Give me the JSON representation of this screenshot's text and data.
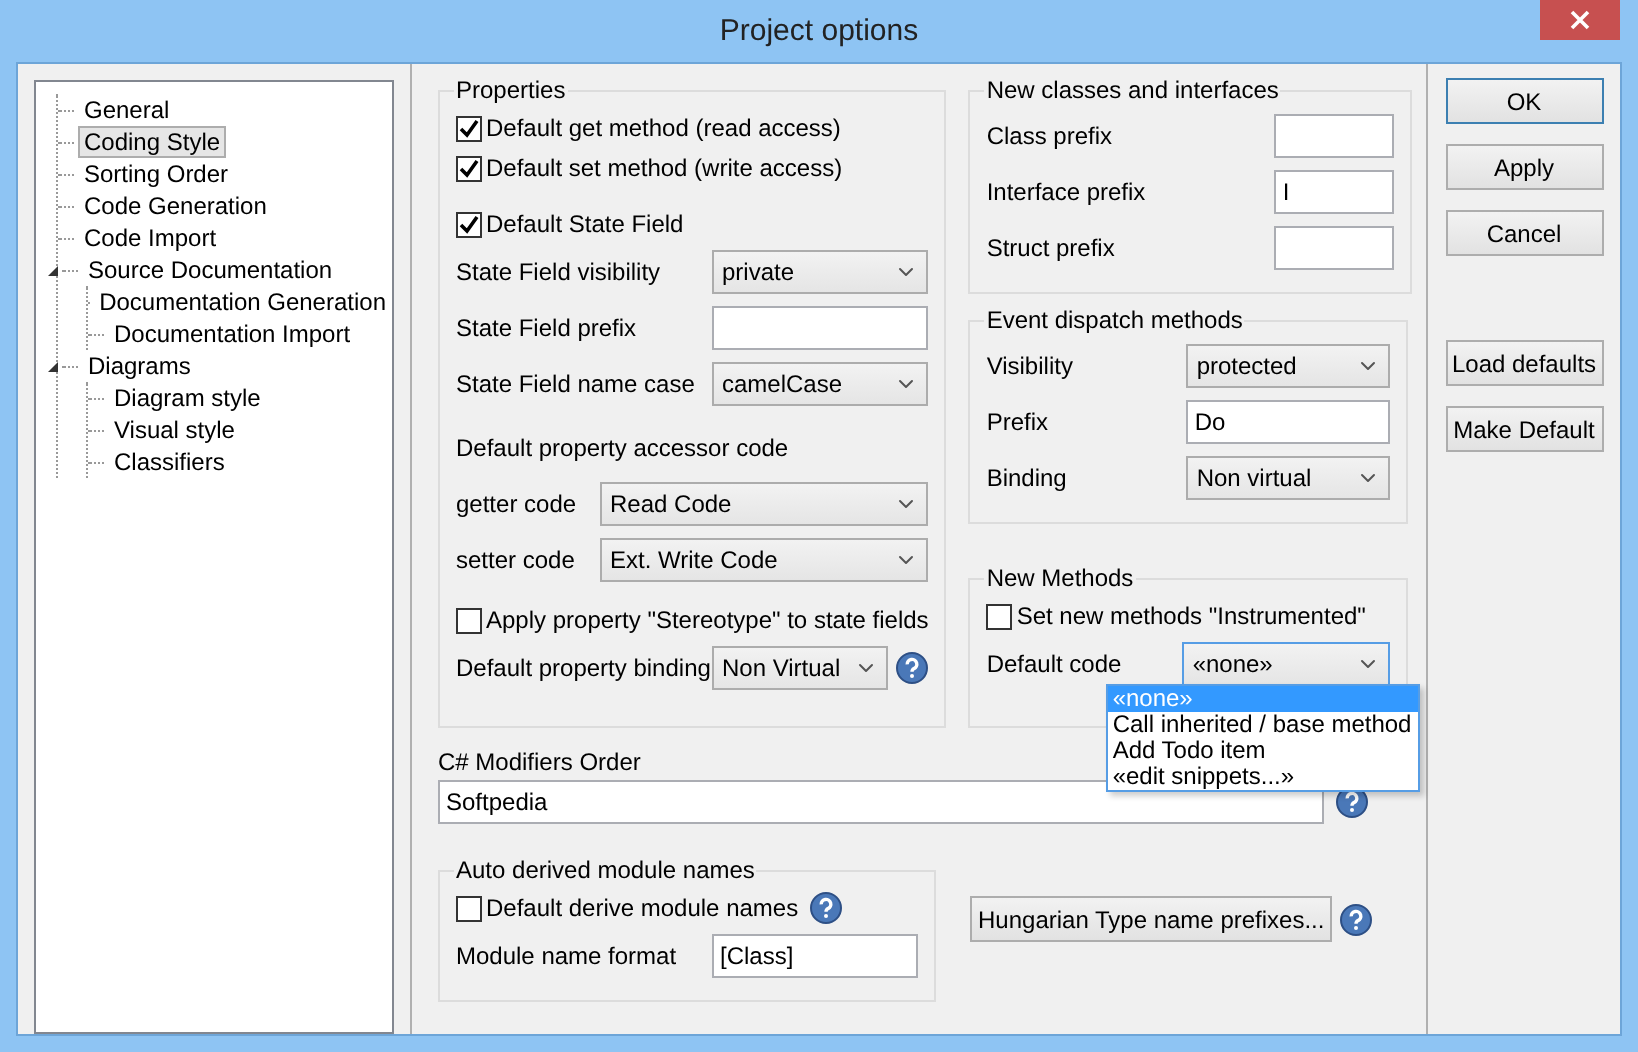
{
  "window": {
    "title": "Project options"
  },
  "tree": [
    {
      "label": "General",
      "selected": false
    },
    {
      "label": "Coding Style",
      "selected": true
    },
    {
      "label": "Sorting Order",
      "selected": false
    },
    {
      "label": "Code Generation",
      "selected": false
    },
    {
      "label": "Code Import",
      "selected": false
    },
    {
      "label": "Source Documentation",
      "selected": false,
      "expanded": true,
      "children": [
        {
          "label": "Documentation Generation",
          "selected": false
        },
        {
          "label": "Documentation Import",
          "selected": false
        }
      ]
    },
    {
      "label": "Diagrams",
      "selected": false,
      "expanded": true,
      "children": [
        {
          "label": "Diagram style",
          "selected": false
        },
        {
          "label": "Visual style",
          "selected": false
        },
        {
          "label": "Classifiers",
          "selected": false
        }
      ]
    }
  ],
  "properties": {
    "title": "Properties",
    "items": [
      {
        "kind": "check",
        "label": "Default get method (read access)",
        "checked": true
      },
      {
        "kind": "check",
        "label": "Default set method (write access)",
        "checked": true
      },
      {
        "kind": "check",
        "label": "Default State Field",
        "checked": true
      },
      {
        "kind": "select",
        "label": "State Field visibility",
        "value": "private"
      },
      {
        "kind": "text",
        "label": "State Field prefix"
      },
      {
        "kind": "select",
        "label": "State Field name case",
        "value": "camelCase"
      },
      {
        "kind": "subgroup",
        "label": "Default property accessor code",
        "items": [
          {
            "kind": "select",
            "label": "getter code",
            "value": "Read Code"
          },
          {
            "kind": "select",
            "label": "setter code",
            "value": "Ext. Write Code"
          }
        ]
      },
      {
        "kind": "check",
        "label": "Apply property \"Stereotype\" to state fields",
        "checked": false
      },
      {
        "kind": "select",
        "label": "Default property binding",
        "value": "Non Virtual",
        "help": true
      }
    ]
  },
  "new_classes": {
    "title": "New classes and interfaces",
    "items": [
      {
        "kind": "text",
        "label": "Class prefix"
      },
      {
        "kind": "text",
        "label": "Interface prefix",
        "value": "I"
      },
      {
        "kind": "text",
        "label": "Struct prefix"
      }
    ]
  },
  "event_dispatch": {
    "title": "Event dispatch methods",
    "items": [
      {
        "kind": "select",
        "label": "Visibility",
        "value": "protected"
      },
      {
        "kind": "text",
        "label": "Prefix",
        "value": "Do"
      },
      {
        "kind": "select",
        "label": "Binding",
        "value": "Non virtual"
      }
    ]
  },
  "new_methods": {
    "title": "New Methods",
    "items": [
      {
        "kind": "check",
        "label": "Set new methods \"Instrumented\"",
        "checked": false
      },
      {
        "kind": "select",
        "label": "Default code",
        "value": "«none»",
        "expanded": true,
        "options": [
          {
            "label": "«none»",
            "selected": true
          },
          {
            "label": "Call inherited / base method",
            "selected": false
          },
          {
            "label": "Add Todo item",
            "selected": false
          },
          {
            "label": "«edit snippets...»",
            "selected": false
          }
        ]
      }
    ]
  },
  "modifiers": {
    "label": "C# Modifiers Order",
    "value": "Softpedia",
    "help": true
  },
  "auto_derived": {
    "title": "Auto derived module names",
    "items": [
      {
        "kind": "check",
        "label": "Default derive module names",
        "checked": false,
        "help": true
      },
      {
        "kind": "text",
        "label": "Module name format",
        "value": "[Class]"
      }
    ]
  },
  "hungarian_button": {
    "label": "Hungarian Type name prefixes...",
    "help": true
  },
  "buttons": [
    {
      "label": "OK",
      "default": true
    },
    {
      "label": "Apply",
      "default": false
    },
    {
      "label": "Cancel",
      "default": false
    }
  ],
  "extra_buttons": [
    {
      "label": "Load defaults"
    },
    {
      "label": "Make Default"
    }
  ]
}
